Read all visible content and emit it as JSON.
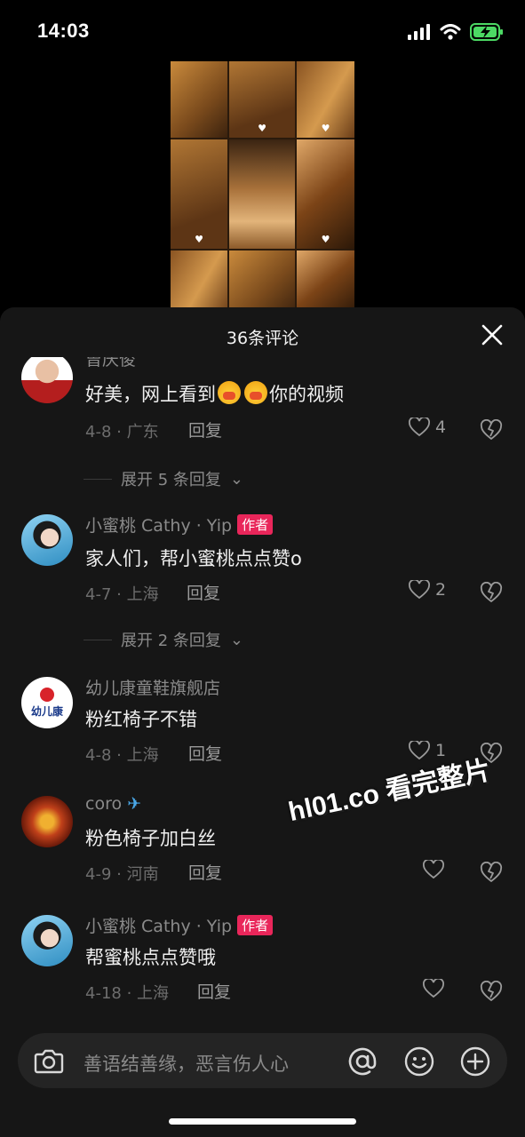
{
  "status_bar": {
    "time": "14:03"
  },
  "sheet": {
    "title": "36条评论"
  },
  "comments": [
    {
      "name": "曾庆俊",
      "text_before": "好美，网上看到",
      "text_after": "你的视频",
      "date": "4-8",
      "location": "广东",
      "reply": "回复",
      "likes": "4"
    },
    {
      "name": "小蜜桃 Cathy · Yip",
      "badge": "作者",
      "text": "家人们，帮小蜜桃点点赞o",
      "date": "4-7",
      "location": "上海",
      "reply": "回复",
      "likes": "2"
    },
    {
      "name": "幼儿康童鞋旗舰店",
      "text": "粉红椅子不错",
      "date": "4-8",
      "location": "上海",
      "reply": "回复",
      "likes": "1"
    },
    {
      "name": "coro",
      "text": "粉色椅子加白丝",
      "date": "4-9",
      "location": "河南",
      "reply": "回复"
    },
    {
      "name": "小蜜桃 Cathy · Yip",
      "badge": "作者",
      "text": "帮蜜桃点点赞哦",
      "date": "4-18",
      "location": "上海",
      "reply": "回复"
    }
  ],
  "expand_replies": [
    {
      "label": "展开 5 条回复"
    },
    {
      "label": "展开 2 条回复"
    }
  ],
  "shop_avatar_text": "幼儿康",
  "watermark": "hl01.co 看完整片",
  "input": {
    "placeholder": "善语结善缘，恶言伤人心"
  },
  "colors": {
    "author_badge": "#e9265a",
    "sheet_bg": "#161616",
    "input_bg": "#242424"
  }
}
